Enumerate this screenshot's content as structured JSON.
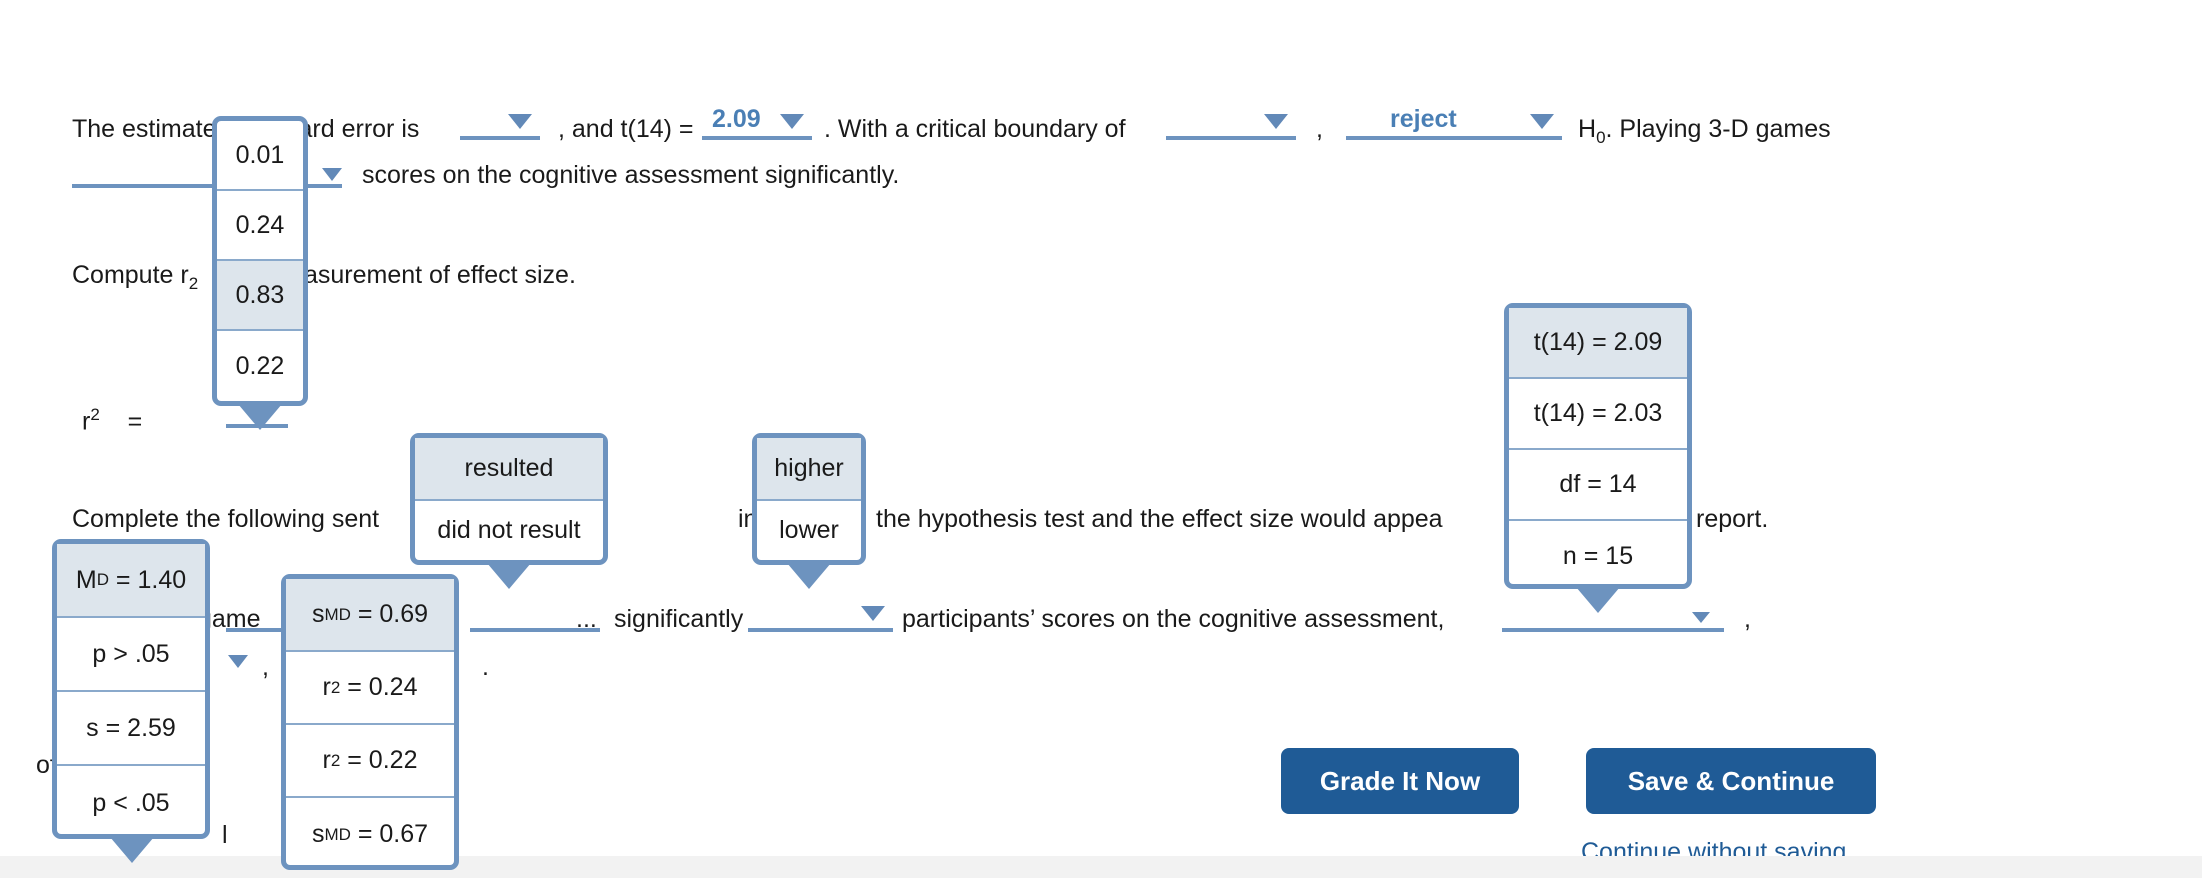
{
  "paragraph1": {
    "part_a": "The estimated standard error is",
    "part_b": ", and t(14) =",
    "t_value": "2.09",
    "part_c": ". With a critical boundary of",
    "comma": ",",
    "decision": "reject",
    "part_d_h0": "H",
    "part_d_h0_sub": "0",
    "part_d": ". Playing 3-D games",
    "line2_tail": "scores on the cognitive assessment significantly."
  },
  "paragraph2": {
    "text": "Compute r₂, a measurement of effect size.",
    "prefix": "Compute r",
    "prefix_sub": "2",
    "suffix": "a measurement of effect size.",
    "clipped_suffix": "asurement of effect size.",
    "r_label": "r",
    "r_sup": "2",
    "equals": "="
  },
  "paragraph3": {
    "line1_a": "Complete the following sent",
    "line1_b": "ing how the",
    "line1_c": "the hypothesis test and the effect size would appea",
    "line1_d": "port.",
    "line1_d_prefix": "re",
    "line2_a": "game",
    "line2_b": "significantly",
    "line2_c": "participants’ scores on the cognitive assessment,",
    "line2_d": ",",
    "line2_dots": "...",
    "line3_a": "of",
    "line3_b": ".",
    "line3_c": "l",
    "line3_comma": ","
  },
  "dropdowns": {
    "se_values": {
      "name": "standard-error-options",
      "options": [
        "0.01",
        "0.24",
        "0.83",
        "0.22"
      ],
      "selected_index": 2
    },
    "result_options": {
      "name": "result-options",
      "options": [
        "resulted",
        "did not result"
      ],
      "selected_index": 0
    },
    "direction_options": {
      "name": "direction-options",
      "options": [
        "higher",
        "lower"
      ],
      "selected_index": 0
    },
    "stat_options": {
      "name": "statistic-options",
      "options": [
        "t(14) = 2.09",
        "t(14) = 2.03",
        "df = 14",
        "n = 15"
      ],
      "selected_index": 0
    },
    "md_options": {
      "name": "mean-difference-options",
      "options": [
        "M_D = 1.40",
        "p > .05",
        "s = 2.59",
        "p < .05"
      ],
      "selected_index": 0,
      "rendered": [
        {
          "main": "M",
          "sub": "D",
          "rest": "= 1.40"
        },
        {
          "main": "p > .05",
          "sub": "",
          "rest": ""
        },
        {
          "main": "s = 2.59",
          "sub": "",
          "rest": ""
        },
        {
          "main": "p < .05",
          "sub": "",
          "rest": ""
        }
      ]
    },
    "smd_options": {
      "name": "effect-size-options",
      "options": [
        "s_MD = 0.69",
        "r² = 0.24",
        "r² = 0.22",
        "s_MD = 0.67"
      ],
      "selected_index": 0,
      "rendered": [
        {
          "main": "s",
          "sub": "MD",
          "rest": "= 0.69"
        },
        {
          "main": "r",
          "sup": "2",
          "rest": "= 0.24"
        },
        {
          "main": "r",
          "sup": "2",
          "rest": "= 0.22"
        },
        {
          "main": "s",
          "sub": "MD",
          "rest": "= 0.67"
        }
      ]
    }
  },
  "actions": {
    "grade_label": "Grade It Now",
    "save_label": "Save & Continue",
    "continue_label": "Continue without saving"
  },
  "colors": {
    "accent_blue": "#6d93bf",
    "link_blue": "#1f5b96",
    "button_blue": "#1f5b96",
    "selected_row": "#dde5ec",
    "value_blue": "#4a7fb5"
  }
}
